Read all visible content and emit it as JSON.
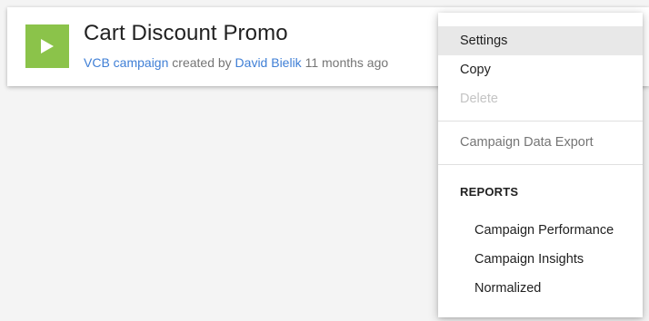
{
  "campaign": {
    "title": "Cart Discount Promo",
    "type_link": "VCB campaign",
    "created_by_text": "created by",
    "author_link": "David Bielik",
    "age": "11 months ago",
    "play_icon": "play-icon",
    "accent_color": "#8bc34a"
  },
  "menu": {
    "settings": "Settings",
    "copy": "Copy",
    "delete": "Delete",
    "export": "Campaign Data Export",
    "reports_heading": "REPORTS",
    "reports": [
      "Campaign Performance",
      "Campaign Insights",
      "Normalized"
    ]
  }
}
